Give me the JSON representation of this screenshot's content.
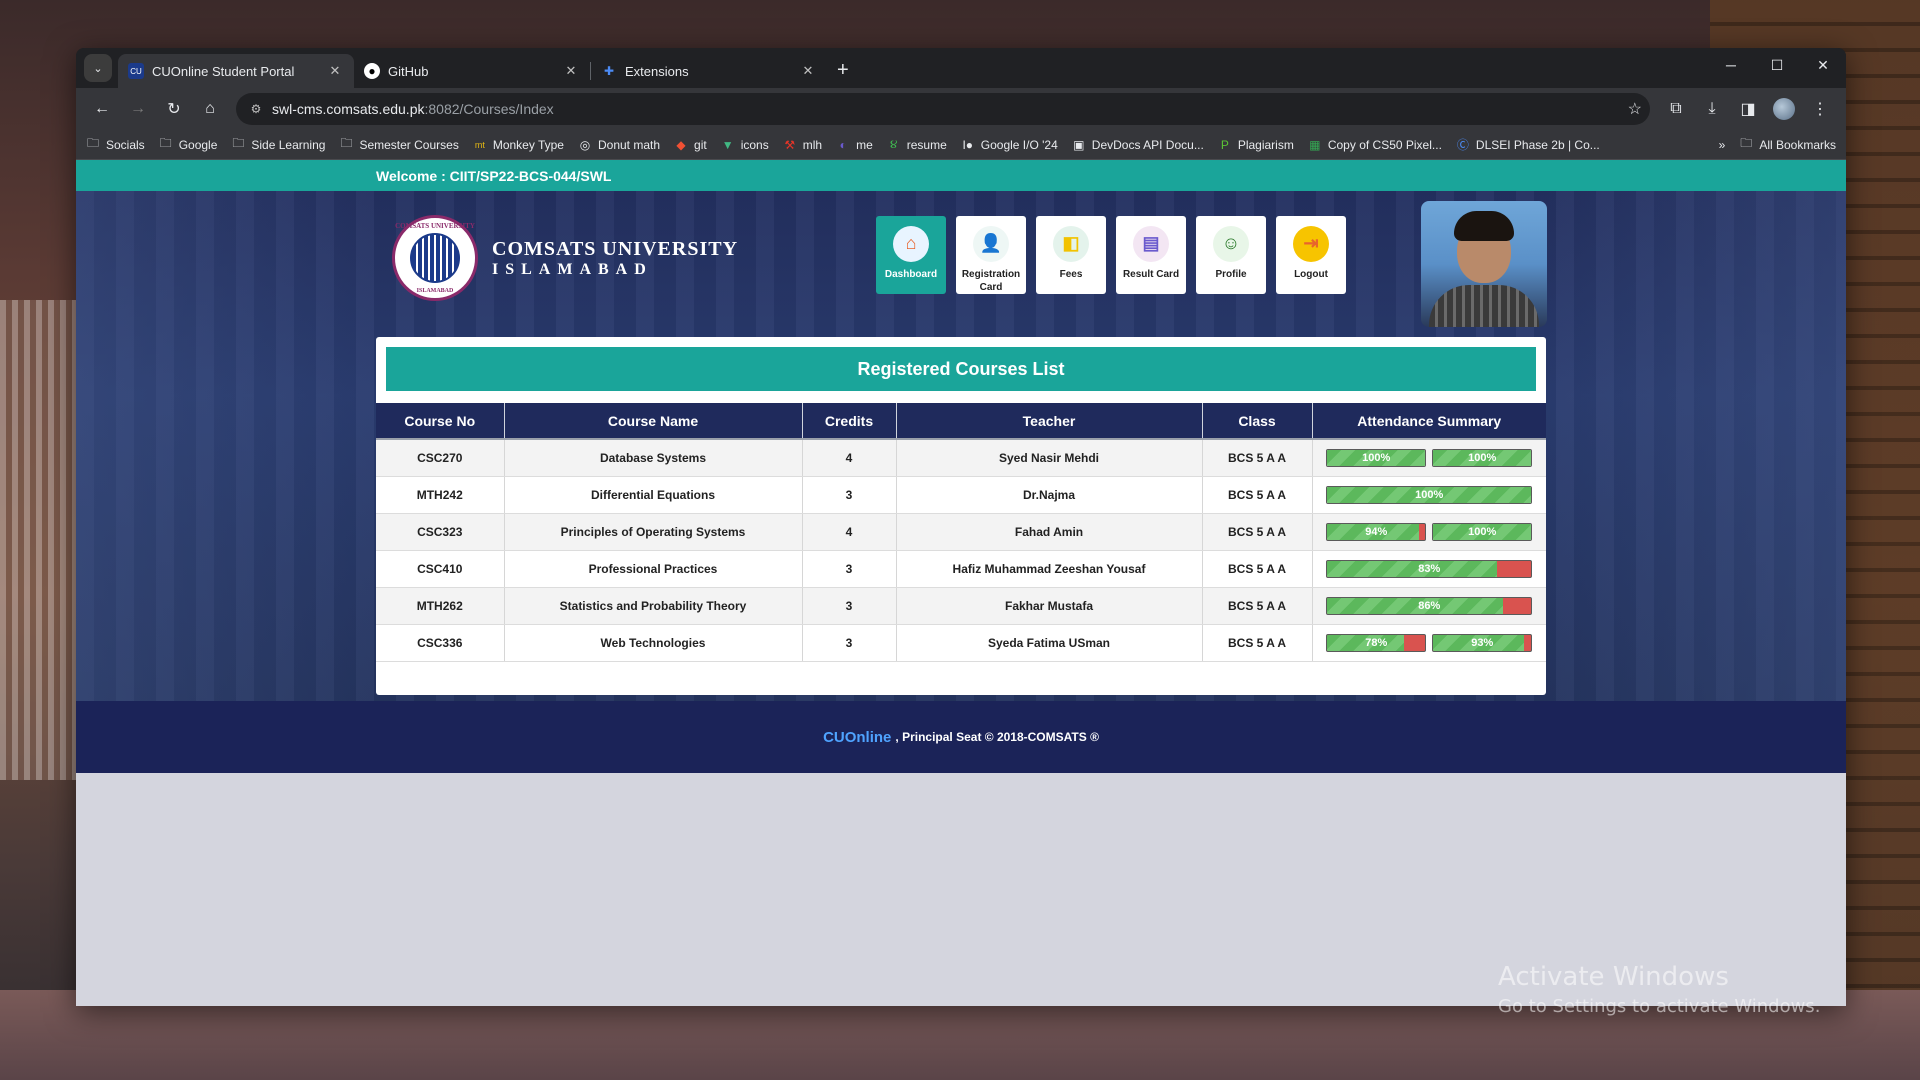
{
  "browser": {
    "tabs": [
      {
        "title": "CUOnline Student Portal",
        "icon": "cu-favicon",
        "active": true
      },
      {
        "title": "GitHub",
        "icon": "github-icon",
        "active": false
      },
      {
        "title": "Extensions",
        "icon": "puzzle-icon",
        "active": false
      }
    ],
    "url_host": "swl-cms.comsats.edu.pk",
    "url_path": ":8082/Courses/Index",
    "bookmarks": [
      {
        "label": "Socials",
        "icon": "folder-icon"
      },
      {
        "label": "Google",
        "icon": "folder-icon"
      },
      {
        "label": "Side Learning",
        "icon": "folder-icon"
      },
      {
        "label": "Semester Courses",
        "icon": "folder-icon"
      },
      {
        "label": "Monkey Type",
        "icon": "mt-icon"
      },
      {
        "label": "Donut math",
        "icon": "donut-icon"
      },
      {
        "label": "git",
        "icon": "git-icon"
      },
      {
        "label": "icons",
        "icon": "v-icon"
      },
      {
        "label": "mlh",
        "icon": "mlh-icon"
      },
      {
        "label": "me",
        "icon": "me-icon"
      },
      {
        "label": "resume",
        "icon": "resume-icon"
      },
      {
        "label": "Google I/O '24",
        "icon": "io-icon"
      },
      {
        "label": "DevDocs API Docu...",
        "icon": "devdocs-icon"
      },
      {
        "label": "Plagiarism",
        "icon": "plag-icon"
      },
      {
        "label": "Copy of CS50 Pixel...",
        "icon": "sheets-icon"
      },
      {
        "label": "DLSEI Phase 2b | Co...",
        "icon": "c-icon"
      }
    ],
    "bookmarks_overflow": "»",
    "all_bookmarks": "All Bookmarks"
  },
  "portal": {
    "welcome": "Welcome : CIIT/SP22-BCS-044/SWL",
    "university_line1": "COMSATS UNIVERSITY",
    "university_line2": "ISLAMABAD",
    "logo_text_top": "COMSATS UNIVERSITY",
    "logo_text_bottom": "ISLAMABAD",
    "nav": [
      {
        "label": "Dashboard",
        "icon": "home-icon",
        "active": true
      },
      {
        "label": "Registration Card",
        "icon": "registration-icon",
        "active": false
      },
      {
        "label": "Fees",
        "icon": "fees-icon",
        "active": false
      },
      {
        "label": "Result Card",
        "icon": "result-card-icon",
        "active": false
      },
      {
        "label": "Profile",
        "icon": "profile-icon",
        "active": false
      },
      {
        "label": "Logout",
        "icon": "logout-icon",
        "active": false
      }
    ],
    "panel_title": "Registered Courses List",
    "columns": [
      "Course No",
      "Course Name",
      "Credits",
      "Teacher",
      "Class",
      "Attendance Summary"
    ],
    "courses": [
      {
        "no": "CSC270",
        "name": "Database Systems",
        "credits": "4",
        "teacher": "Syed Nasir Mehdi",
        "class": "BCS 5 A A",
        "attendance": [
          {
            "label": "100%",
            "value": 100
          },
          {
            "label": "100%",
            "value": 100
          }
        ]
      },
      {
        "no": "MTH242",
        "name": "Differential Equations",
        "credits": "3",
        "teacher": "Dr.Najma",
        "class": "BCS 5 A A",
        "attendance": [
          {
            "label": "100%",
            "value": 100
          }
        ]
      },
      {
        "no": "CSC323",
        "name": "Principles of Operating Systems",
        "credits": "4",
        "teacher": "Fahad Amin",
        "class": "BCS 5 A A",
        "attendance": [
          {
            "label": "94%",
            "value": 94
          },
          {
            "label": "100%",
            "value": 100
          }
        ]
      },
      {
        "no": "CSC410",
        "name": "Professional Practices",
        "credits": "3",
        "teacher": "Hafiz Muhammad Zeeshan Yousaf",
        "class": "BCS 5 A A",
        "attendance": [
          {
            "label": "83%",
            "value": 83
          }
        ]
      },
      {
        "no": "MTH262",
        "name": "Statistics and Probability Theory",
        "credits": "3",
        "teacher": "Fakhar Mustafa",
        "class": "BCS 5 A A",
        "attendance": [
          {
            "label": "86%",
            "value": 86
          }
        ]
      },
      {
        "no": "CSC336",
        "name": "Web Technologies",
        "credits": "3",
        "teacher": "Syeda Fatima USman",
        "class": "BCS 5 A A",
        "attendance": [
          {
            "label": "78%",
            "value": 78
          },
          {
            "label": "93%",
            "value": 93
          }
        ]
      }
    ],
    "footer_brand": "CUOnline",
    "footer_text": ", Principal Seat © 2018-COMSATS ®"
  },
  "watermark": {
    "line1": "Activate Windows",
    "line2": "Go to Settings to activate Windows."
  },
  "colors": {
    "teal": "#1aa59a",
    "navy": "#1f2a5c",
    "present": "#5cb85c",
    "absent": "#d9534f"
  }
}
